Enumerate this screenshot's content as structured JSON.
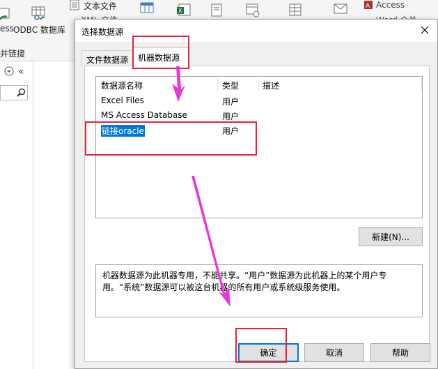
{
  "ribbon": {
    "buttons": [
      {
        "label": "ess",
        "icon": "access-import-icon"
      },
      {
        "label": "ODBC 数据库",
        "icon": "odbc-database-icon"
      }
    ],
    "text_file_label": "文本文件",
    "xml_label": "XML 文件",
    "access_label": "Access",
    "word_label": "Word 合并",
    "group_label": "并链接"
  },
  "nav": {
    "collapse_label": "«",
    "dropdown_label": "▾"
  },
  "dialog": {
    "title": "选择数据源",
    "tabs": [
      {
        "label": "文件数据源",
        "active": false
      },
      {
        "label": "机器数据源",
        "active": true
      }
    ],
    "columns": [
      "数据源名称",
      "类型",
      "描述"
    ],
    "rows": [
      {
        "name": "Excel Files",
        "type": "用户",
        "desc": "",
        "selected": false
      },
      {
        "name": "MS Access Database",
        "type": "用户",
        "desc": "",
        "selected": false
      },
      {
        "name": "链接oracle",
        "type": "用户",
        "desc": "",
        "selected": true
      }
    ],
    "new_button": "新建(N)...",
    "description": "机器数据源为此机器专用，不能共享。“用户”数据源为此机器上的某个用户专用。“系统”数据源可以被这台机器的所有用户或系统级服务使用。",
    "ok_button": "确定",
    "cancel_button": "取消",
    "help_button": "帮助"
  },
  "annotation": {
    "color": "#e8213a",
    "arrow_color": "#e53ad9"
  },
  "colors": {
    "selection": "#0078d7",
    "dialog_bg": "#f0f0f0"
  }
}
